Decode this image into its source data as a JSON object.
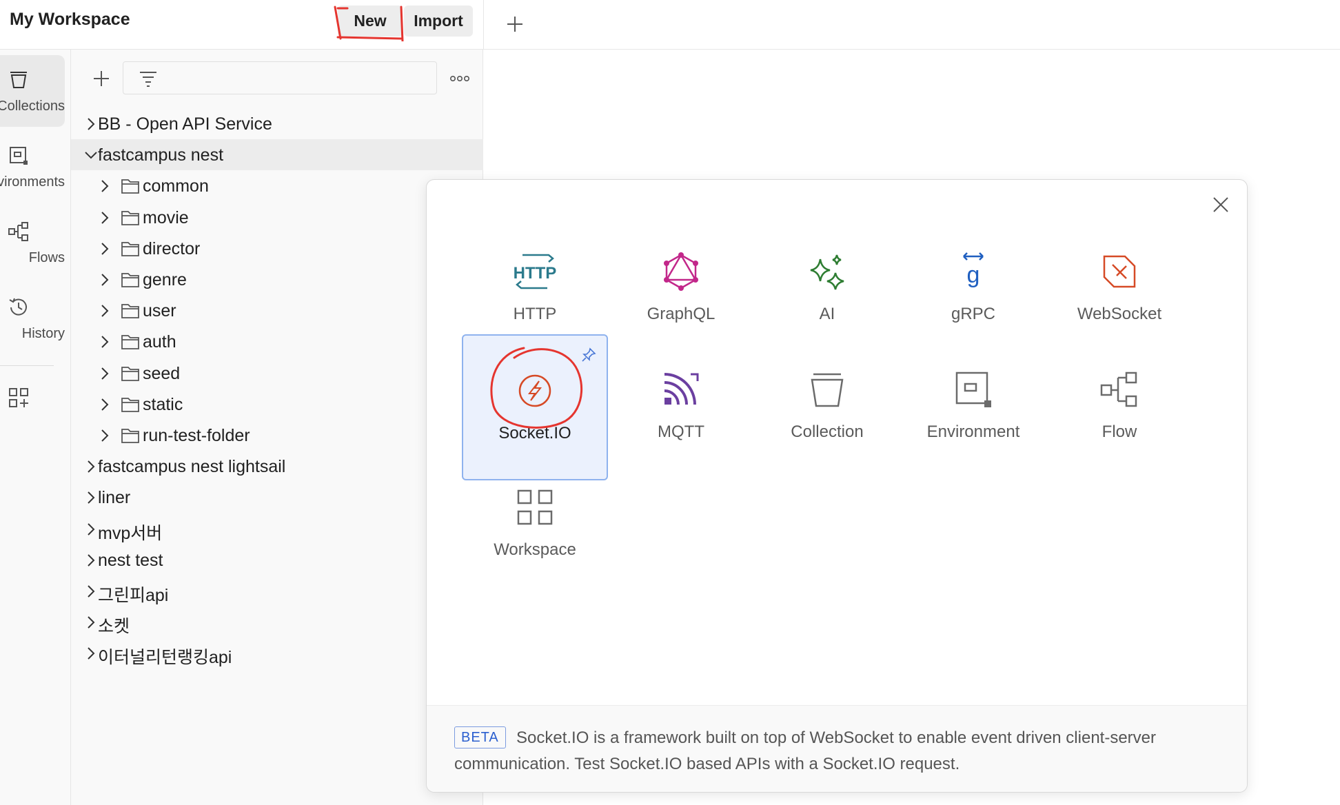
{
  "header": {
    "workspace_title": "My Workspace",
    "new_label": "New",
    "import_label": "Import"
  },
  "rail": {
    "items": [
      {
        "label": "Collections",
        "icon": "collection-icon",
        "active": true
      },
      {
        "label": "Environments",
        "icon": "environment-icon",
        "active": false
      },
      {
        "label": "Flows",
        "icon": "flows-icon",
        "active": false
      },
      {
        "label": "History",
        "icon": "history-icon",
        "active": false
      }
    ],
    "extra_icon": "add-apps-icon"
  },
  "sidebar": {
    "filter_placeholder": "",
    "tree": [
      {
        "label": "BB - Open API Service",
        "level": 0,
        "expanded": false,
        "folder": false
      },
      {
        "label": "fastcampus nest",
        "level": 0,
        "expanded": true,
        "folder": false,
        "selected": true
      },
      {
        "label": "common",
        "level": 1,
        "folder": true
      },
      {
        "label": "movie",
        "level": 1,
        "folder": true
      },
      {
        "label": "director",
        "level": 1,
        "folder": true
      },
      {
        "label": "genre",
        "level": 1,
        "folder": true
      },
      {
        "label": "user",
        "level": 1,
        "folder": true
      },
      {
        "label": "auth",
        "level": 1,
        "folder": true
      },
      {
        "label": "seed",
        "level": 1,
        "folder": true
      },
      {
        "label": "static",
        "level": 1,
        "folder": true
      },
      {
        "label": "run-test-folder",
        "level": 1,
        "folder": true
      },
      {
        "label": "fastcampus nest lightsail",
        "level": 0,
        "expanded": false,
        "folder": false
      },
      {
        "label": "liner",
        "level": 0,
        "expanded": false,
        "folder": false
      },
      {
        "label": "mvp서버",
        "level": 0,
        "expanded": false,
        "folder": false
      },
      {
        "label": "nest test",
        "level": 0,
        "expanded": false,
        "folder": false
      },
      {
        "label": "그린피api",
        "level": 0,
        "expanded": false,
        "folder": false
      },
      {
        "label": "소켓",
        "level": 0,
        "expanded": false,
        "folder": false
      },
      {
        "label": "이터널리턴랭킹api",
        "level": 0,
        "expanded": false,
        "folder": false
      }
    ]
  },
  "modal": {
    "tiles": [
      {
        "label": "HTTP",
        "icon": "http-icon",
        "color": "#2b7a8c"
      },
      {
        "label": "GraphQL",
        "icon": "graphql-icon",
        "color": "#c2278a"
      },
      {
        "label": "AI",
        "icon": "ai-sparkle-icon",
        "color": "#2e7d32"
      },
      {
        "label": "gRPC",
        "icon": "grpc-icon",
        "color": "#1f5fc0"
      },
      {
        "label": "WebSocket",
        "icon": "websocket-icon",
        "color": "#d64a26"
      },
      {
        "label": "Socket.IO",
        "icon": "socketio-icon",
        "color": "#d64a26",
        "selected": true
      },
      {
        "label": "MQTT",
        "icon": "mqtt-icon",
        "color": "#6b3fa0"
      },
      {
        "label": "Collection",
        "icon": "collection-icon",
        "color": "#6b6b6b"
      },
      {
        "label": "Environment",
        "icon": "environment-icon",
        "color": "#6b6b6b"
      },
      {
        "label": "Flow",
        "icon": "flow-icon",
        "color": "#6b6b6b"
      },
      {
        "label": "Workspace",
        "icon": "workspace-icon",
        "color": "#6b6b6b"
      }
    ],
    "footer": {
      "badge": "BETA",
      "description": "Socket.IO is a framework built on top of WebSocket to enable event driven client-server communication. Test Socket.IO based APIs with a Socket.IO request."
    }
  },
  "colors": {
    "annotation_red": "#e5352f",
    "selected_tile_bg": "#ebf1fd",
    "selected_tile_border": "#8eb2ee",
    "beta_blue": "#2b5fcf"
  }
}
